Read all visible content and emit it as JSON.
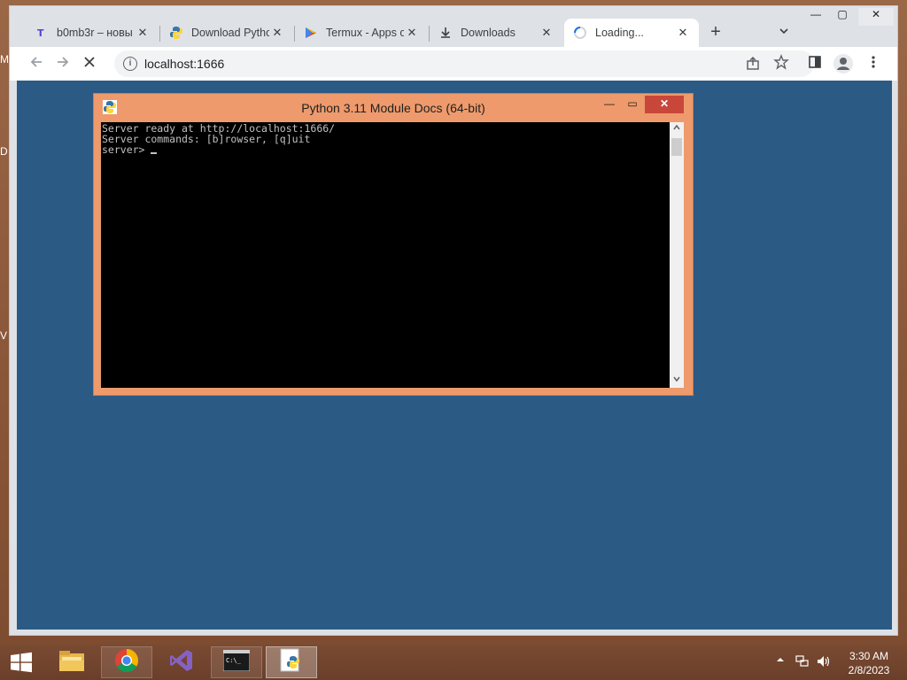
{
  "desktop": {
    "side_letters": [
      "M",
      "D",
      "V"
    ]
  },
  "browser": {
    "tabs": [
      {
        "label": "b0mb3r – новы",
        "icon": "tilda-icon",
        "close": "✕"
      },
      {
        "label": "Download Pytho",
        "icon": "python-icon",
        "close": "✕"
      },
      {
        "label": "Termux - Apps o",
        "icon": "google-play-icon",
        "close": "✕"
      },
      {
        "label": "Downloads",
        "icon": "download-icon",
        "close": "✕"
      },
      {
        "label": "Loading...",
        "icon": "loading-spinner-icon",
        "close": "✕",
        "active": true
      }
    ],
    "new_tab": "+",
    "url": "localhost:1666",
    "window_controls": {
      "minimize": "—",
      "maximize": "▢",
      "close": "✕"
    }
  },
  "console": {
    "title": "Python 3.11 Module Docs (64-bit)",
    "lines": [
      "Server ready at http://localhost:1666/",
      "Server commands: [b]rowser, [q]uit",
      "server> "
    ],
    "controls": {
      "minimize": "—",
      "maximize": "▭",
      "close": "✕"
    }
  },
  "taskbar": {
    "apps": [
      "file-explorer-icon",
      "chrome-icon",
      "visual-studio-icon",
      "cmd-icon",
      "python-icon"
    ],
    "clock": {
      "time": "3:30 AM",
      "date": "2/8/2023"
    }
  },
  "colors": {
    "page_background": "#2b5a84",
    "console_frame": "#ee9a6c",
    "console_close": "#c8473a",
    "taskbar": "#6a3f2a"
  }
}
